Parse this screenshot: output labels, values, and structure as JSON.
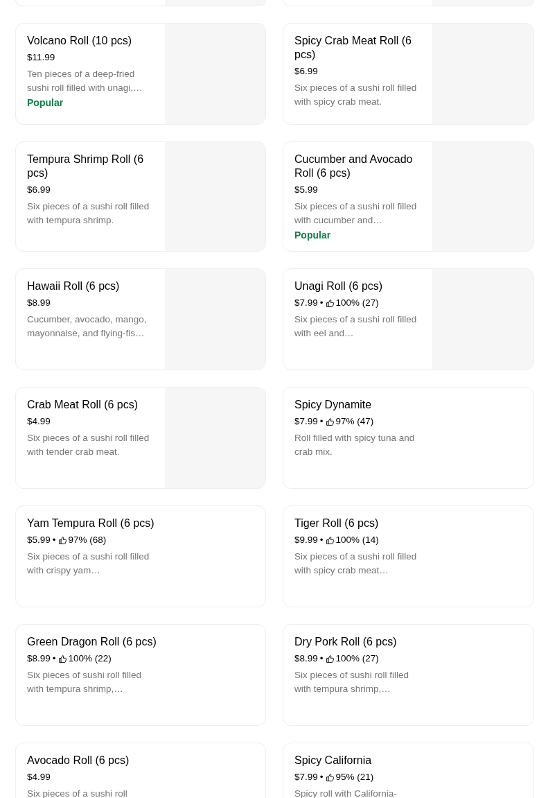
{
  "cut_cards": [
    {
      "image": true
    },
    {
      "image": true
    }
  ],
  "items": [
    {
      "name": "Volcano Roll (10 pcs)",
      "price": "$11.99",
      "description": "Ten pieces of a deep-fried sushi roll filled with unagi,…",
      "badge": "Popular",
      "image": true
    },
    {
      "name": "Spicy Crab Meat Roll (6 pcs)",
      "price": "$6.99",
      "description": "Six pieces of a sushi roll filled with spicy crab meat.",
      "image": true
    },
    {
      "name": "Tempura Shrimp Roll (6 pcs)",
      "price": "$6.99",
      "description": "Six pieces of a sushi roll filled with tempura shrimp.",
      "image": true
    },
    {
      "name": "Cucumber and Avocado Roll (6 pcs)",
      "price": "$5.99",
      "description": "Six pieces of a sushi roll filled with cucumber and…",
      "badge": "Popular",
      "image": true
    },
    {
      "name": "Hawaii Roll (6 pcs)",
      "price": "$8.99",
      "description": "Cucumber, avocado, mango, mayonnaise, and flying-fis…",
      "image": true
    },
    {
      "name": "Unagi Roll (6 pcs)",
      "price": "$7.99",
      "separator": "•",
      "rating": "100% (27)",
      "description": "Six pieces of a sushi roll filled with eel and…",
      "image": true
    },
    {
      "name": "Crab Meat Roll (6 pcs)",
      "price": "$4.99",
      "description": "Six pieces of a sushi roll filled with tender crab meat.",
      "image": true
    },
    {
      "name": "Spicy Dynamite",
      "price": "$7.99",
      "separator": "•",
      "rating": "97% (47)",
      "description": "Roll filled with spicy tuna and crab mix.",
      "image": false
    },
    {
      "name": "Yam Tempura Roll (6 pcs)",
      "price": "$5.99",
      "separator": "•",
      "rating": "97% (68)",
      "description": "Six pieces of a sushi roll filled with crispy yam…",
      "image": false
    },
    {
      "name": "Tiger Roll (6 pcs)",
      "price": "$9.99",
      "separator": "•",
      "rating": "100% (14)",
      "description": "Six pieces of a sushi roll filled with spicy crab meat…",
      "image": false
    },
    {
      "name": "Green Dragon Roll (6 pcs)",
      "price": "$8.99",
      "separator": "•",
      "rating": "100% (22)",
      "description": "Six pieces of sushi roll filled with tempura shrimp,…",
      "image": false
    },
    {
      "name": "Dry Pork Roll (6 pcs)",
      "price": "$8.99",
      "separator": "•",
      "rating": "100% (27)",
      "description": "Six pieces of sushi roll filled with tempura shrimp,…",
      "image": false
    },
    {
      "name": "Avocado Roll (6 pcs)",
      "price": "$4.99",
      "description": "Six pieces of a sushi roll",
      "image": false
    },
    {
      "name": "Spicy California",
      "price": "$7.99",
      "separator": "•",
      "rating": "95% (21)",
      "description": "Spicy roll with California-",
      "image": false
    }
  ]
}
